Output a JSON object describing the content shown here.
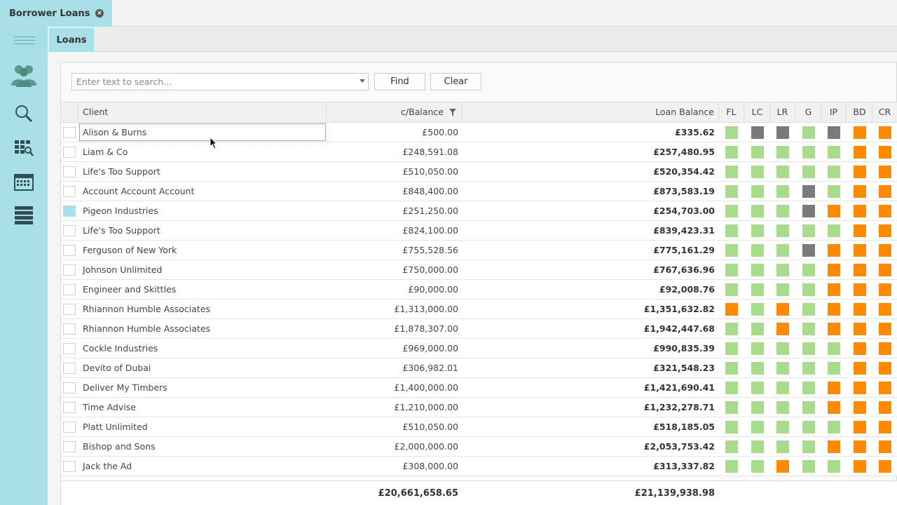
{
  "doc_tab": {
    "label": "Borrower Loans",
    "close_icon": "close-icon"
  },
  "module_tab": {
    "label": "Loans"
  },
  "sidebar": {
    "items": [
      {
        "icon": "users-icon"
      },
      {
        "icon": "search-icon"
      },
      {
        "icon": "grid-search-icon"
      },
      {
        "icon": "calendar-icon"
      },
      {
        "icon": "list-icon"
      }
    ]
  },
  "search": {
    "placeholder": "Enter text to search...",
    "value": ""
  },
  "buttons": {
    "find": "Find",
    "clear": "Clear"
  },
  "columns": {
    "client": "Client",
    "cbalance": "c/Balance",
    "loan_balance": "Loan Balance",
    "flags": [
      "FL",
      "LC",
      "LR",
      "G",
      "IP",
      "BD",
      "CR"
    ]
  },
  "colors": {
    "green": "#a8dc8c",
    "grey": "#7a7a7a",
    "orange": "#ff8a00",
    "accent": "#a9dfe7"
  },
  "rows": [
    {
      "client": "Alison & Burns",
      "cbalance": "£500.00",
      "loan": "£335.62",
      "flags": [
        "green",
        "grey",
        "grey",
        "green",
        "grey",
        "orange",
        "orange"
      ],
      "checked": false
    },
    {
      "client": "Liam & Co",
      "cbalance": "£248,591.08",
      "loan": "£257,480.95",
      "flags": [
        "green",
        "green",
        "green",
        "green",
        "green",
        "orange",
        "orange"
      ],
      "checked": false
    },
    {
      "client": "Life's Too Support",
      "cbalance": "£510,050.00",
      "loan": "£520,354.42",
      "flags": [
        "green",
        "green",
        "green",
        "green",
        "green",
        "orange",
        "orange"
      ],
      "checked": false
    },
    {
      "client": "Account Account Account",
      "cbalance": "£848,400.00",
      "loan": "£873,583.19",
      "flags": [
        "green",
        "green",
        "green",
        "grey",
        "green",
        "orange",
        "orange"
      ],
      "checked": false
    },
    {
      "client": "Pigeon Industries",
      "cbalance": "£251,250.00",
      "loan": "£254,703.00",
      "flags": [
        "green",
        "green",
        "green",
        "grey",
        "orange",
        "orange",
        "orange"
      ],
      "checked": true
    },
    {
      "client": "Life's Too Support",
      "cbalance": "£824,100.00",
      "loan": "£839,423.31",
      "flags": [
        "green",
        "green",
        "green",
        "green",
        "green",
        "orange",
        "orange"
      ],
      "checked": false
    },
    {
      "client": "Ferguson of New York",
      "cbalance": "£755,528.56",
      "loan": "£775,161.29",
      "flags": [
        "green",
        "green",
        "green",
        "grey",
        "orange",
        "orange",
        "orange"
      ],
      "checked": false
    },
    {
      "client": "Johnson Unlimited",
      "cbalance": "£750,000.00",
      "loan": "£767,636.96",
      "flags": [
        "green",
        "green",
        "green",
        "green",
        "orange",
        "orange",
        "orange"
      ],
      "checked": false
    },
    {
      "client": "Engineer and Skittles",
      "cbalance": "£90,000.00",
      "loan": "£92,008.76",
      "flags": [
        "green",
        "green",
        "green",
        "green",
        "orange",
        "orange",
        "orange"
      ],
      "checked": false
    },
    {
      "client": "Rhiannon Humble Associates",
      "cbalance": "£1,313,000.00",
      "loan": "£1,351,632.82",
      "flags": [
        "orange",
        "green",
        "orange",
        "green",
        "orange",
        "orange",
        "orange"
      ],
      "checked": false
    },
    {
      "client": "Rhiannon Humble Associates",
      "cbalance": "£1,878,307.00",
      "loan": "£1,942,447.68",
      "flags": [
        "green",
        "green",
        "orange",
        "green",
        "orange",
        "orange",
        "orange"
      ],
      "checked": false
    },
    {
      "client": "Cockle Industries",
      "cbalance": "£969,000.00",
      "loan": "£990,835.39",
      "flags": [
        "green",
        "green",
        "green",
        "green",
        "green",
        "orange",
        "orange"
      ],
      "checked": false
    },
    {
      "client": "Devito of Dubai",
      "cbalance": "£306,982.01",
      "loan": "£321,548.23",
      "flags": [
        "green",
        "green",
        "green",
        "green",
        "green",
        "orange",
        "orange"
      ],
      "checked": false
    },
    {
      "client": "Deliver My Timbers",
      "cbalance": "£1,400,000.00",
      "loan": "£1,421,690.41",
      "flags": [
        "green",
        "green",
        "green",
        "green",
        "orange",
        "orange",
        "orange"
      ],
      "checked": false
    },
    {
      "client": "Time Advise",
      "cbalance": "£1,210,000.00",
      "loan": "£1,232,278.71",
      "flags": [
        "green",
        "green",
        "green",
        "green",
        "orange",
        "orange",
        "orange"
      ],
      "checked": false
    },
    {
      "client": "Platt Unlimited",
      "cbalance": "£510,050.00",
      "loan": "£518,185.05",
      "flags": [
        "green",
        "green",
        "green",
        "green",
        "green",
        "orange",
        "orange"
      ],
      "checked": false
    },
    {
      "client": "Bishop and Sons",
      "cbalance": "£2,000,000.00",
      "loan": "£2,053,753.42",
      "flags": [
        "green",
        "green",
        "green",
        "green",
        "orange",
        "orange",
        "orange"
      ],
      "checked": false
    },
    {
      "client": "Jack the Ad",
      "cbalance": "£308,000.00",
      "loan": "£313,337.82",
      "flags": [
        "green",
        "green",
        "orange",
        "green",
        "green",
        "orange",
        "orange"
      ],
      "checked": false
    }
  ],
  "totals": {
    "cbalance": "£20,661,658.65",
    "loan": "£21,139,938.98"
  }
}
